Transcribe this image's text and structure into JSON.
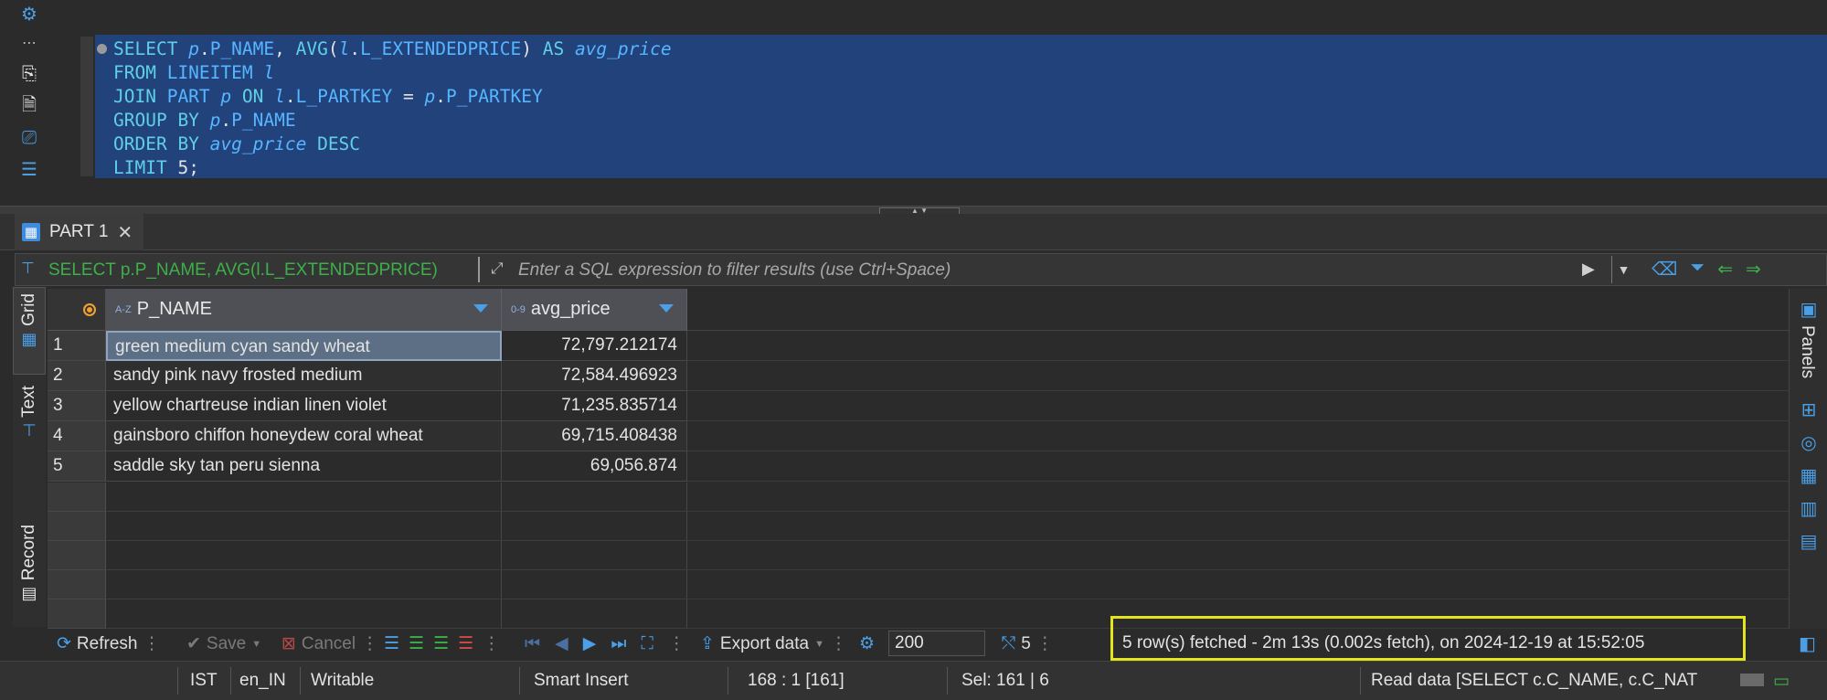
{
  "editor": {
    "gutter_icons": [
      "gear-icon",
      "more-icon",
      "run-script-icon",
      "run-error-icon",
      "export-icon",
      "outline-icon"
    ],
    "sql_lines": [
      [
        {
          "t": "SELECT ",
          "c": "kw"
        },
        {
          "t": "p",
          "c": "al"
        },
        {
          "t": ".",
          "c": "plain"
        },
        {
          "t": "P_NAME",
          "c": "id"
        },
        {
          "t": ", ",
          "c": "plain"
        },
        {
          "t": "AVG",
          "c": "kw"
        },
        {
          "t": "(",
          "c": "plain"
        },
        {
          "t": "l",
          "c": "al"
        },
        {
          "t": ".",
          "c": "plain"
        },
        {
          "t": "L_EXTENDEDPRICE",
          "c": "id"
        },
        {
          "t": ") ",
          "c": "plain"
        },
        {
          "t": "AS ",
          "c": "kw"
        },
        {
          "t": "avg_price",
          "c": "al"
        }
      ],
      [
        {
          "t": "FROM ",
          "c": "kw"
        },
        {
          "t": "LINEITEM ",
          "c": "id"
        },
        {
          "t": "l",
          "c": "al"
        }
      ],
      [
        {
          "t": "JOIN ",
          "c": "kw"
        },
        {
          "t": "PART ",
          "c": "id"
        },
        {
          "t": "p ",
          "c": "al"
        },
        {
          "t": "ON ",
          "c": "kw"
        },
        {
          "t": "l",
          "c": "al"
        },
        {
          "t": ".",
          "c": "plain"
        },
        {
          "t": "L_PARTKEY",
          "c": "id"
        },
        {
          "t": " = ",
          "c": "plain"
        },
        {
          "t": "p",
          "c": "al"
        },
        {
          "t": ".",
          "c": "plain"
        },
        {
          "t": "P_PARTKEY",
          "c": "id"
        }
      ],
      [
        {
          "t": "GROUP BY ",
          "c": "kw"
        },
        {
          "t": "p",
          "c": "al"
        },
        {
          "t": ".",
          "c": "plain"
        },
        {
          "t": "P_NAME",
          "c": "id"
        }
      ],
      [
        {
          "t": "ORDER BY ",
          "c": "kw"
        },
        {
          "t": "avg_price ",
          "c": "al"
        },
        {
          "t": "DESC",
          "c": "kw"
        }
      ],
      [
        {
          "t": "LIMIT ",
          "c": "kw"
        },
        {
          "t": "5;",
          "c": "num"
        }
      ]
    ]
  },
  "result_tab": {
    "label": "PART 1",
    "icon": "grid-table-icon"
  },
  "filter": {
    "query": "SELECT p.P_NAME, AVG(l.L_EXTENDEDPRICE)",
    "placeholder": "Enter a SQL expression to filter results (use Ctrl+Space)"
  },
  "side_tabs": {
    "grid": "Grid",
    "text": "Text",
    "record": "Record"
  },
  "right_panel": {
    "label": "Panels"
  },
  "grid": {
    "columns": [
      {
        "type": "A-Z",
        "name": "P_NAME"
      },
      {
        "type": "0-9",
        "name": "avg_price"
      }
    ],
    "rows": [
      {
        "num": "1",
        "p_name": "green medium cyan sandy wheat",
        "avg_price": "72,797.212174"
      },
      {
        "num": "2",
        "p_name": "sandy pink navy frosted medium",
        "avg_price": "72,584.496923"
      },
      {
        "num": "3",
        "p_name": "yellow chartreuse indian linen violet",
        "avg_price": "71,235.835714"
      },
      {
        "num": "4",
        "p_name": "gainsboro chiffon honeydew coral wheat",
        "avg_price": "69,715.408438"
      },
      {
        "num": "5",
        "p_name": "saddle sky tan peru sienna",
        "avg_price": "69,056.874"
      }
    ]
  },
  "toolbar": {
    "refresh": "Refresh",
    "save": "Save",
    "cancel": "Cancel",
    "export": "Export data",
    "limit": "200",
    "row_count": "5",
    "status": "5 row(s) fetched - 2m 13s (0.002s fetch), on 2024-12-19 at 15:52:05"
  },
  "statusbar": {
    "timezone": "IST",
    "locale": "en_IN",
    "mode": "Writable",
    "insert": "Smart Insert",
    "position": "168 : 1 [161]",
    "selection": "Sel: 161 | 6",
    "task": "Read data [SELECT   c.C_NAME,  c.C_NAT"
  },
  "colors": {
    "accent": "#4a9fe6",
    "highlight_border": "#e4e41c",
    "selection": "#22427c"
  }
}
